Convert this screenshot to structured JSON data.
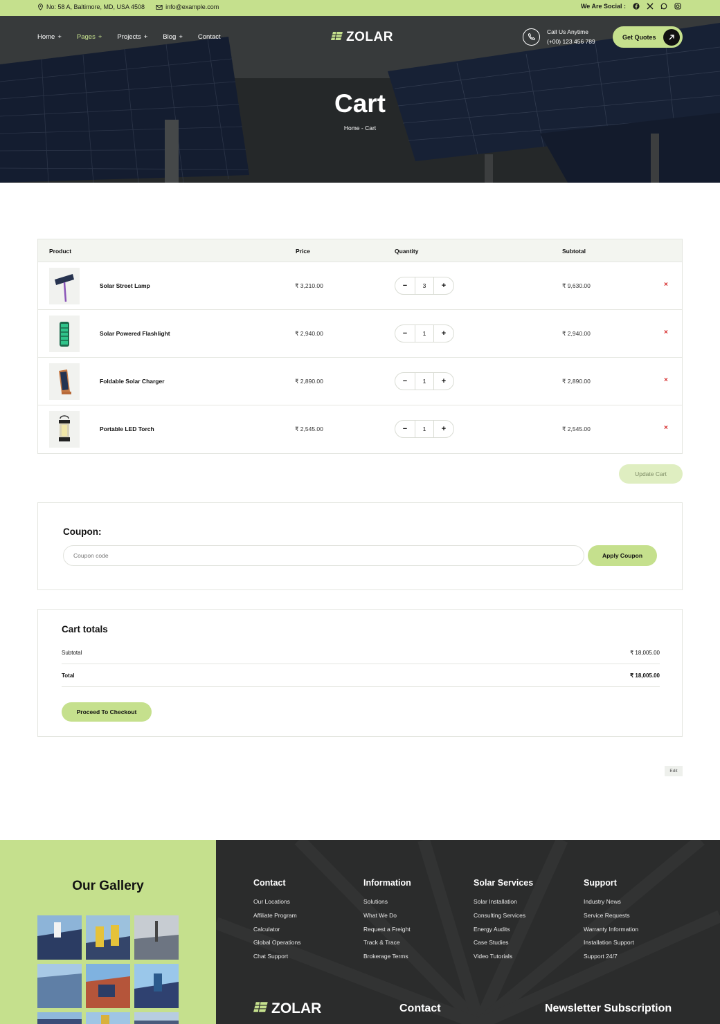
{
  "topbar": {
    "address": "No: 58 A, Baltimore, MD, USA 4508",
    "email": "info@example.com",
    "social_label": "We Are Social :"
  },
  "nav": {
    "items": [
      {
        "label": "Home"
      },
      {
        "label": "Pages"
      },
      {
        "label": "Projects"
      },
      {
        "label": "Blog"
      },
      {
        "label": "Contact"
      }
    ]
  },
  "brand": {
    "name": "ZOLAR"
  },
  "call": {
    "label": "Call Us Anytime",
    "phone": "(+00) 123 456 789"
  },
  "cta": {
    "label": "Get Quotes"
  },
  "hero": {
    "title": "Cart",
    "breadcrumb_home": "Home",
    "breadcrumb_sep": "-",
    "breadcrumb_current": "Cart"
  },
  "table": {
    "headers": {
      "product": "Product",
      "price": "Price",
      "quantity": "Quantity",
      "subtotal": "Subtotal"
    },
    "rows": [
      {
        "name": "Solar Street Lamp",
        "price": "₹ 3,210.00",
        "qty": "3",
        "subtotal": "₹ 9,630.00"
      },
      {
        "name": "Solar Powered Flashlight",
        "price": "₹ 2,940.00",
        "qty": "1",
        "subtotal": "₹ 2,940.00"
      },
      {
        "name": "Foldable Solar Charger",
        "price": "₹ 2,890.00",
        "qty": "1",
        "subtotal": "₹ 2,890.00"
      },
      {
        "name": "Portable LED Torch",
        "price": "₹ 2,545.00",
        "qty": "1",
        "subtotal": "₹ 2,545.00"
      }
    ],
    "minus": "−",
    "plus": "+",
    "remove": "×"
  },
  "update_label": "Update Cart",
  "coupon": {
    "title": "Coupon:",
    "placeholder": "Coupon code",
    "apply_label": "Apply Coupon"
  },
  "totals": {
    "title": "Cart totals",
    "subtotal_label": "Subtotal",
    "subtotal_value": "₹ 18,005.00",
    "total_label": "Total",
    "total_value": "₹ 18,005.00",
    "checkout_label": "Proceed To Checkout"
  },
  "edit_label": "Edit",
  "footer": {
    "gallery_title": "Our Gallery",
    "columns": [
      {
        "title": "Contact",
        "links": [
          "Our Locations",
          "Affiliate Program",
          "Calculator",
          "Global Operations",
          "Chat Support"
        ]
      },
      {
        "title": "Information",
        "links": [
          "Solutions",
          "What We Do",
          "Request a Freight",
          "Track & Trace",
          "Brokerage Terms"
        ]
      },
      {
        "title": "Solar Services",
        "links": [
          "Solar Installation",
          "Consulting Services",
          "Energy Audits",
          "Case Studies",
          "Video Tutorials"
        ]
      },
      {
        "title": "Support",
        "links": [
          "Industry News",
          "Service Requests",
          "Warranty Information",
          "Installation Support",
          "Support 24/7"
        ]
      }
    ],
    "bottom_contact": "Contact",
    "newsletter": "Newsletter Subscription"
  },
  "colors": {
    "accent": "#c5e08d",
    "dark": "#2b2c2c",
    "remove": "#d62b2b"
  }
}
